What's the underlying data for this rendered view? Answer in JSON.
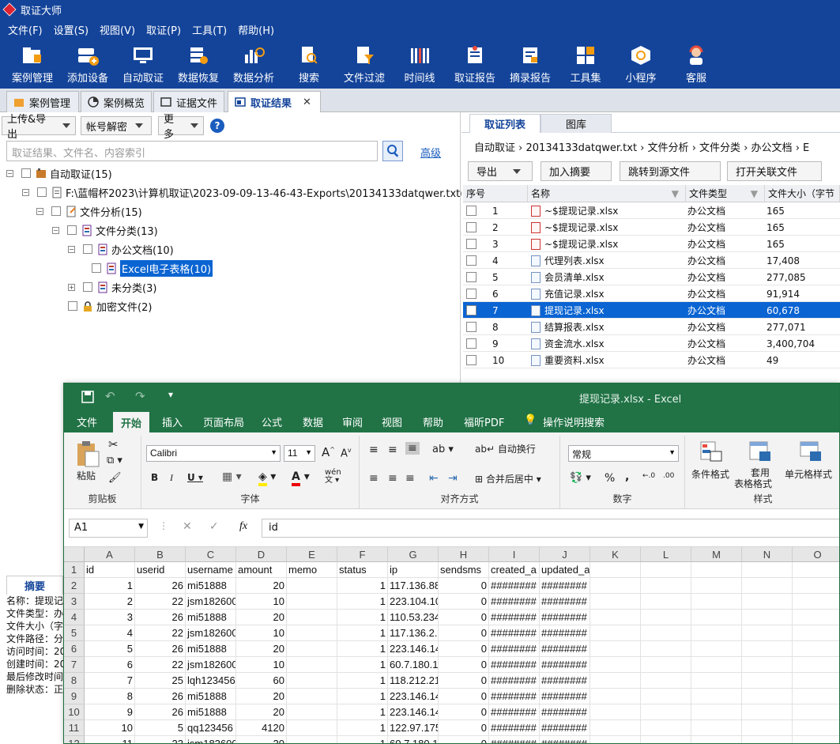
{
  "app": {
    "title": "取证大师"
  },
  "menu": [
    "文件(F)",
    "设置(S)",
    "视图(V)",
    "取证(P)",
    "工具(T)",
    "帮助(H)"
  ],
  "toolbar": [
    "案例管理",
    "添加设备",
    "自动取证",
    "数据恢复",
    "数据分析",
    "搜索",
    "文件过滤",
    "时间线",
    "取证报告",
    "摘录报告",
    "工具集",
    "小程序",
    "客服"
  ],
  "tabs": [
    "案例管理",
    "案例概览",
    "证据文件",
    "取证结果"
  ],
  "left": {
    "upload_label": "上传&导出",
    "decrypt_label": "帐号解密",
    "more_label": "更多",
    "help_label": "?",
    "search_placeholder": "取证结果、文件名、内容索引",
    "advanced_label": "高级",
    "tree": [
      "自动取证(15)",
      "F:\\蓝帽杯2023\\计算机取证\\2023-09-09-13-46-43-Exports\\20134133datqwer.txt(15)",
      "文件分析(15)",
      "文件分类(13)",
      "办公文档(10)",
      "Excel电子表格(10)",
      "未分类(3)",
      "加密文件(2)"
    ]
  },
  "right": {
    "tabs": [
      "取证列表",
      "图库"
    ],
    "breadcrumb": [
      "自动取证",
      "20134133datqwer.txt",
      "文件分析",
      "文件分类",
      "办公文档",
      "E"
    ],
    "actions": {
      "export": "导出",
      "add_summary": "加入摘要",
      "jump_source": "跳转到源文件",
      "open_related": "打开关联文件"
    },
    "columns": [
      "序号",
      "名称",
      "文件类型",
      "文件大小（字节"
    ],
    "rows": [
      {
        "no": "1",
        "name": "~$提现记录.xlsx",
        "type": "办公文档",
        "size": "165"
      },
      {
        "no": "2",
        "name": "~$提现记录.xlsx",
        "type": "办公文档",
        "size": "165"
      },
      {
        "no": "3",
        "name": "~$提现记录.xlsx",
        "type": "办公文档",
        "size": "165"
      },
      {
        "no": "4",
        "name": "代理列表.xlsx",
        "type": "办公文档",
        "size": "17,408"
      },
      {
        "no": "5",
        "name": "会员清单.xlsx",
        "type": "办公文档",
        "size": "277,085"
      },
      {
        "no": "6",
        "name": "充值记录.xlsx",
        "type": "办公文档",
        "size": "91,914"
      },
      {
        "no": "7",
        "name": "提现记录.xlsx",
        "type": "办公文档",
        "size": "60,678"
      },
      {
        "no": "8",
        "name": "结算报表.xlsx",
        "type": "办公文档",
        "size": "277,071"
      },
      {
        "no": "9",
        "name": "资金流水.xlsx",
        "type": "办公文档",
        "size": "3,400,704"
      },
      {
        "no": "10",
        "name": "重要资料.xlsx",
        "type": "办公文档",
        "size": "49"
      }
    ],
    "selected_index": 6
  },
  "summary": {
    "tab": "摘要",
    "lines": [
      "名称：提现记",
      "文件类型：办",
      "文件大小（字",
      "文件路径：分",
      "访问时间：20",
      "创建时间：20",
      "最后修改时间",
      "删除状态：正"
    ]
  },
  "excel": {
    "title": "提现记录.xlsx  -  Excel",
    "tabs": [
      "文件",
      "开始",
      "插入",
      "页面布局",
      "公式",
      "数据",
      "审阅",
      "视图",
      "帮助",
      "福昕PDF",
      "操作说明搜索"
    ],
    "groups": {
      "clipboard": "剪贴板",
      "font": "字体",
      "align": "对齐方式",
      "number": "数字",
      "styles": "样式"
    },
    "paste": "粘贴",
    "font_name": "Calibri",
    "font_size": "11",
    "wrap": "自动换行",
    "merge": "合并后居中",
    "num_format": "常规",
    "cond_fmt": "条件格式",
    "table_fmt_1": "套用",
    "table_fmt_2": "表格格式",
    "cell_style": "单元格样式",
    "namebox": "A1",
    "formula": "id",
    "col_letters": [
      "A",
      "B",
      "C",
      "D",
      "E",
      "F",
      "G",
      "H",
      "I",
      "J",
      "K",
      "L",
      "M",
      "N",
      "O"
    ],
    "rows": [
      [
        "id",
        "userid",
        "username",
        "amount",
        "memo",
        "status",
        "ip",
        "sendsms",
        "created_a",
        "updated_at"
      ],
      [
        "1",
        "26",
        "mi51888",
        "20",
        "",
        "1",
        "117.136.88",
        "0",
        "########",
        "########"
      ],
      [
        "2",
        "22",
        "jsm182600",
        "10",
        "",
        "1",
        "223.104.10",
        "0",
        "########",
        "########"
      ],
      [
        "3",
        "26",
        "mi51888",
        "20",
        "",
        "1",
        "110.53.234",
        "0",
        "########",
        "########"
      ],
      [
        "4",
        "22",
        "jsm182600",
        "10",
        "",
        "1",
        "117.136.2.",
        "0",
        "########",
        "########"
      ],
      [
        "5",
        "26",
        "mi51888",
        "20",
        "",
        "1",
        "223.146.14",
        "0",
        "########",
        "########"
      ],
      [
        "6",
        "22",
        "jsm182600",
        "10",
        "",
        "1",
        "60.7.180.1",
        "0",
        "########",
        "########"
      ],
      [
        "7",
        "25",
        "lqh123456",
        "60",
        "",
        "1",
        "118.212.21",
        "0",
        "########",
        "########"
      ],
      [
        "8",
        "26",
        "mi51888",
        "20",
        "",
        "1",
        "223.146.14",
        "0",
        "########",
        "########"
      ],
      [
        "9",
        "26",
        "mi51888",
        "20",
        "",
        "1",
        "223.146.14",
        "0",
        "########",
        "########"
      ],
      [
        "10",
        "5",
        "qq123456",
        "4120",
        "",
        "1",
        "122.97.175",
        "0",
        "########",
        "########"
      ],
      [
        "11",
        "22",
        "jsm182600",
        "20",
        "",
        "1",
        "60.7.180.1",
        "0",
        "########",
        "########"
      ]
    ]
  }
}
